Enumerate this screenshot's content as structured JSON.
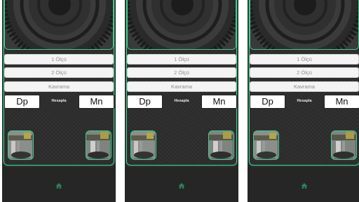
{
  "accent_color": "#3fd08f",
  "panel_color": "#262626",
  "screens": [
    {
      "inputs": {
        "first_placeholder": "1 Ölçü",
        "second_placeholder": "2 Ölçü",
        "third_placeholder": "Kavrama"
      },
      "buttons": {
        "dp": "Dp",
        "calculate": "Hesapla",
        "mn": "Mn"
      },
      "nav": {
        "home_icon": "home-icon"
      }
    },
    {
      "inputs": {
        "first_placeholder": "1 Ölçü",
        "second_placeholder": "2 Ölçü",
        "third_placeholder": "Kavrama"
      },
      "buttons": {
        "dp": "Dp",
        "calculate": "Hesapla",
        "mn": "Mn"
      },
      "nav": {
        "home_icon": "home-icon"
      }
    },
    {
      "inputs": {
        "first_placeholder": "1 Ölçü",
        "second_placeholder": "2 Ölçü",
        "third_placeholder": "Kavrama"
      },
      "buttons": {
        "dp": "Dp",
        "calculate": "Hesapla",
        "mn": "Mn"
      },
      "nav": {
        "home_icon": "home-icon"
      }
    }
  ]
}
